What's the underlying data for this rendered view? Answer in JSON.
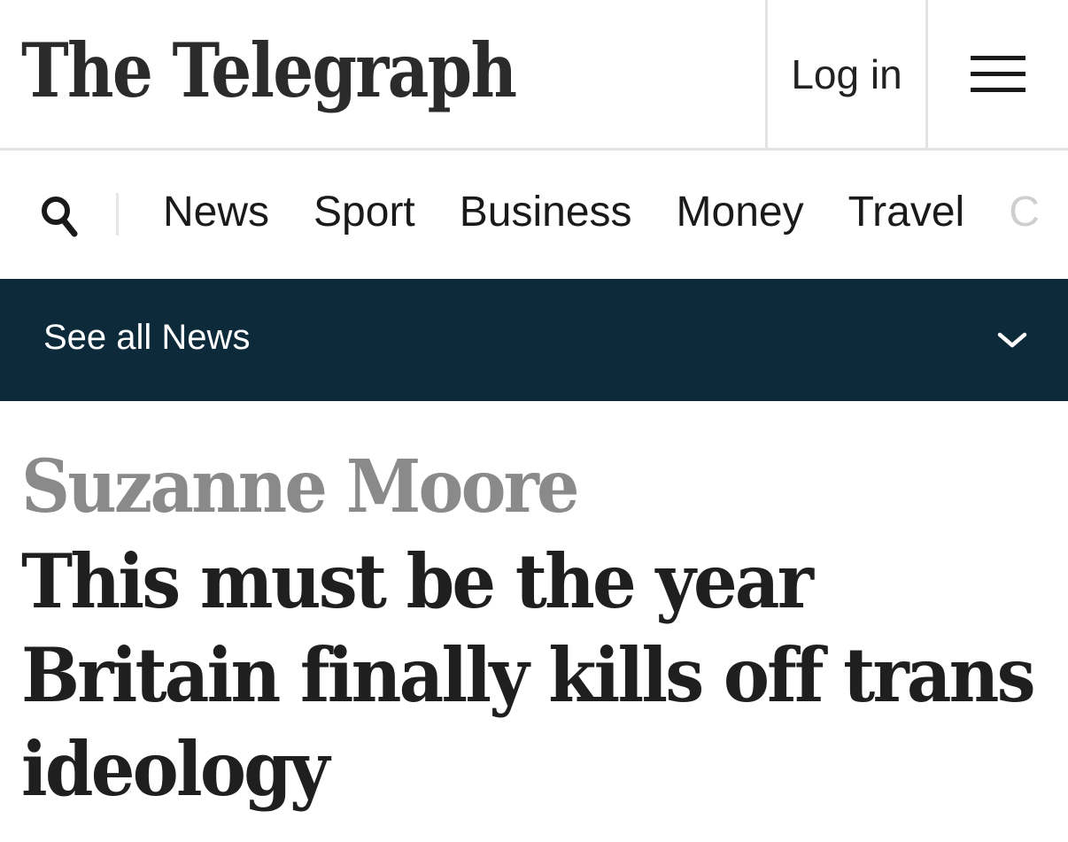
{
  "header": {
    "logo_text": "The Telegraph",
    "login_label": "Log in",
    "menu_icon": "hamburger-menu-icon"
  },
  "nav": {
    "search_icon": "search-icon",
    "items": [
      "News",
      "Sport",
      "Business",
      "Money",
      "Travel",
      "C"
    ]
  },
  "subnav": {
    "label": "See all News",
    "chevron_icon": "chevron-down-icon",
    "background": "#0d2a3b"
  },
  "article": {
    "author": "Suzanne Moore",
    "headline": "This must be the year Britain finally kills off trans ideology"
  }
}
